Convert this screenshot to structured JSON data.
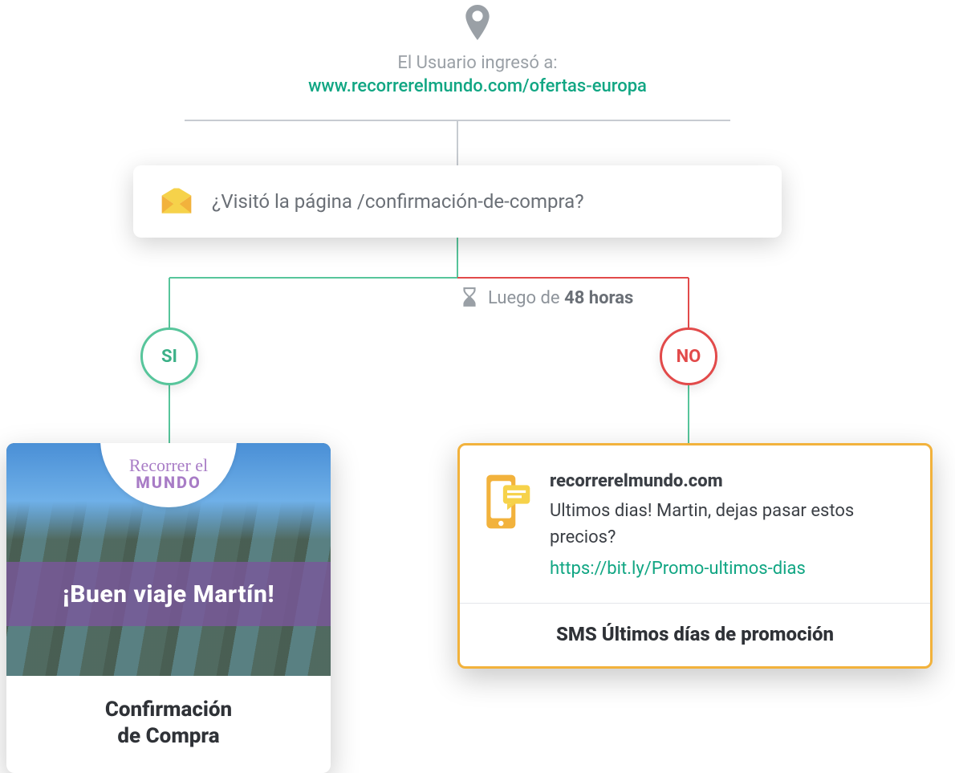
{
  "colors": {
    "green": "#11a683",
    "greenStroke": "#57c59b",
    "red": "#e24a4a",
    "amber": "#f2b23c",
    "gray": "#9aa0a6"
  },
  "trigger": {
    "label": "El Usuario ingresó a:",
    "url": "www.recorrerelmundo.com/ofertas-europa"
  },
  "condition": {
    "question": "¿Visitó la página /confirmación-de-compra?"
  },
  "delay": {
    "prefix": "Luego de",
    "highlight": "48 horas"
  },
  "branches": {
    "yes_label": "SI",
    "no_label": "NO"
  },
  "email_card": {
    "logo_line1": "Recorrer el",
    "logo_line2": "MUNDO",
    "ribbon": "¡Buen viaje Martín!",
    "caption_line1": "Confirmación",
    "caption_line2": "de Compra"
  },
  "sms_card": {
    "sender": "recorrerelmundo.com",
    "message": "Ultimos dias! Martin, dejas pasar estos precios?",
    "link": "https://bit.ly/Promo-ultimos-dias",
    "caption": "SMS Últimos días de promoción"
  }
}
